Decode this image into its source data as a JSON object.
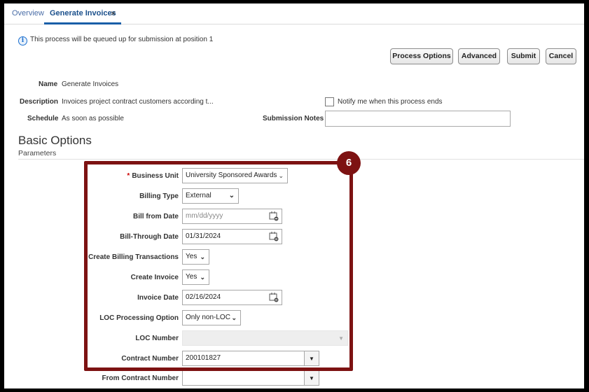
{
  "tabs": {
    "overview": "Overview",
    "generate": "Generate Invoices",
    "close": "×"
  },
  "info_message": "This process will be queued up for submission at position 1",
  "toolbar": {
    "process_options": "Process Options",
    "advanced": "Advanced",
    "submit": "Submit",
    "cancel": "Cancel"
  },
  "details": {
    "name_label": "Name",
    "name_value": "Generate Invoices",
    "description_label": "Description",
    "description_value": "Invoices project contract customers according t...",
    "schedule_label": "Schedule",
    "schedule_value": "As soon as possible",
    "notify_label": "Notify me when this process ends",
    "notes_label": "Submission Notes"
  },
  "section": {
    "title": "Basic Options",
    "subtitle": "Parameters"
  },
  "params": {
    "business_unit": {
      "label": "Business Unit",
      "value": "University Sponsored Awards"
    },
    "billing_type": {
      "label": "Billing Type",
      "value": "External"
    },
    "bill_from_date": {
      "label": "Bill from Date",
      "placeholder": "mm/dd/yyyy"
    },
    "bill_through_date": {
      "label": "Bill-Through Date",
      "value": "01/31/2024"
    },
    "create_billing_transactions": {
      "label": "Create Billing Transactions",
      "value": "Yes"
    },
    "create_invoice": {
      "label": "Create Invoice",
      "value": "Yes"
    },
    "invoice_date": {
      "label": "Invoice Date",
      "value": "02/16/2024"
    },
    "loc_processing_option": {
      "label": "LOC Processing Option",
      "value": "Only non-LOC"
    },
    "loc_number": {
      "label": "LOC Number",
      "value": ""
    },
    "contract_number": {
      "label": "Contract Number",
      "value": "200101827"
    },
    "from_contract_number": {
      "label": "From Contract Number",
      "value": ""
    }
  },
  "callout": {
    "number": "6",
    "color": "#7d1212"
  },
  "colors": {
    "link": "#4a6da7",
    "accent": "#1a5fa8"
  }
}
